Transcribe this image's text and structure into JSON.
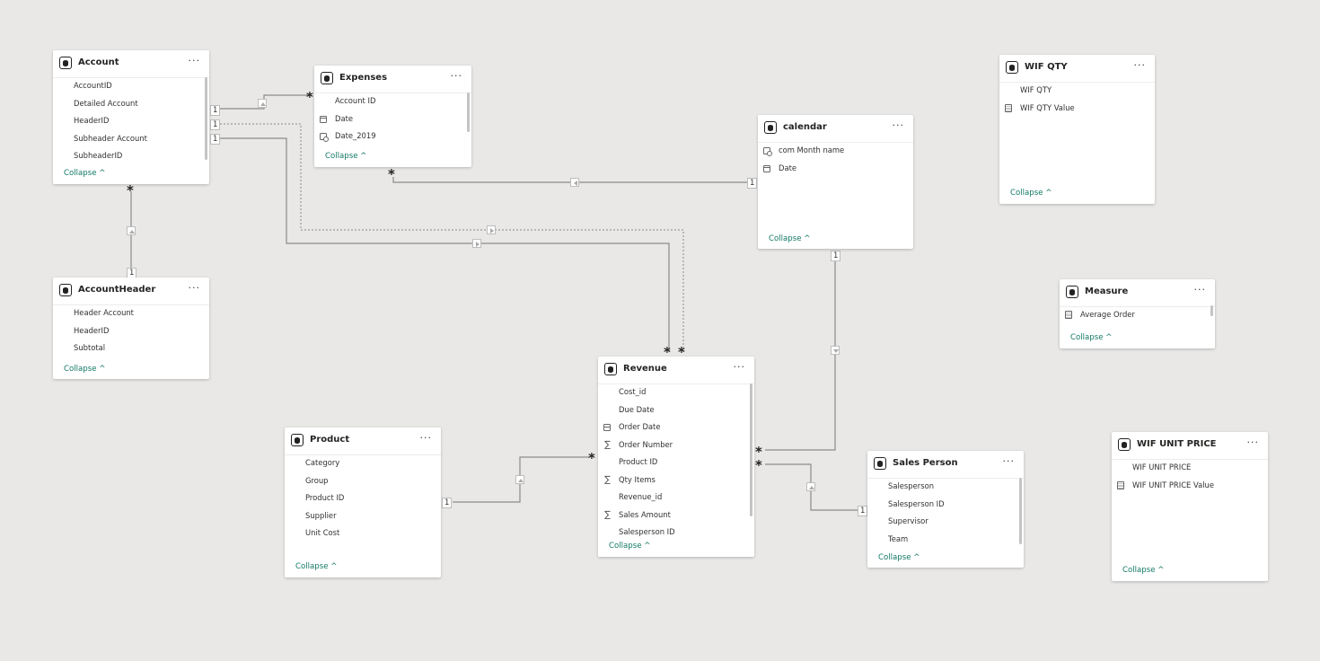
{
  "ui": {
    "collapse_label": "Collapse",
    "more_label": "···"
  },
  "tables": {
    "account": {
      "title": "Account",
      "fields": [
        "AccountID",
        "Detailed Account",
        "HeaderID",
        "Subheader Account",
        "SubheaderID"
      ]
    },
    "expenses": {
      "title": "Expenses",
      "fields": [
        "Account ID",
        "Date",
        "Date_2019"
      ]
    },
    "calendar": {
      "title": "calendar",
      "fields": [
        "com Month name",
        "Date"
      ]
    },
    "wif_qty": {
      "title": "WIF QTY",
      "fields": [
        "WIF QTY",
        "WIF QTY Value"
      ]
    },
    "account_header": {
      "title": "AccountHeader",
      "fields": [
        "Header Account",
        "HeaderID",
        "Subtotal"
      ]
    },
    "measure": {
      "title": "Measure",
      "fields": [
        "Average Order"
      ]
    },
    "product": {
      "title": "Product",
      "fields": [
        "Category",
        "Group",
        "Product ID",
        "Supplier",
        "Unit Cost"
      ]
    },
    "revenue": {
      "title": "Revenue",
      "fields": [
        "Cost_id",
        "Due Date",
        "Order Date",
        "Order Number",
        "Product ID",
        "Qty Items",
        "Revenue_id",
        "Sales Amount",
        "Salesperson ID"
      ]
    },
    "sales_person": {
      "title": "Sales Person",
      "fields": [
        "Salesperson",
        "Salesperson ID",
        "Supervisor",
        "Team"
      ]
    },
    "wif_unit_price": {
      "title": "WIF UNIT PRICE",
      "fields": [
        "WIF UNIT PRICE",
        "WIF UNIT PRICE Value"
      ]
    }
  },
  "cardinality": {
    "one": "1",
    "many": "*"
  }
}
